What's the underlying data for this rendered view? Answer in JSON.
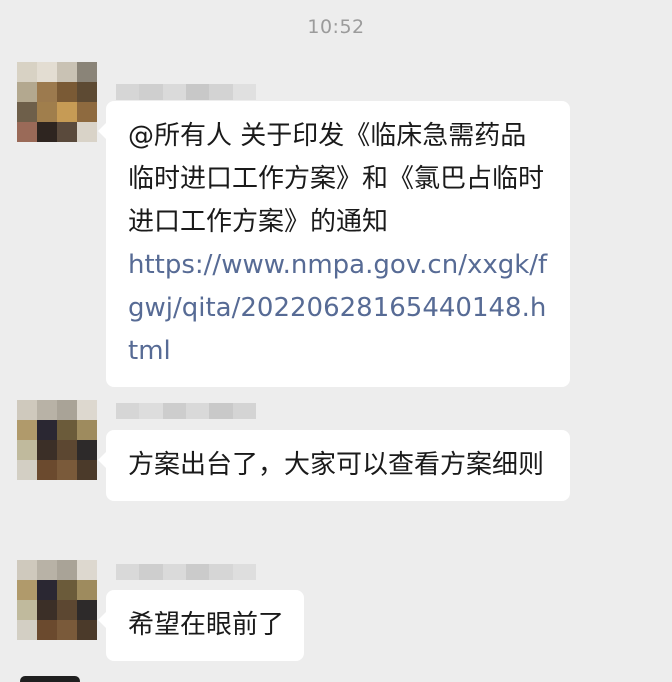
{
  "chat": {
    "timestamp": "10:52",
    "messages": [
      {
        "text": "@所有人  关于印发《临床急需药品临时进口工作方案》和《氯巴占临时进口工作方案》的通知",
        "link": "https://www.nmpa.gov.cn/xxgk/fgwj/qita/20220628165440148.html"
      },
      {
        "text": "方案出台了，大家可以查看方案细则"
      },
      {
        "text": "希望在眼前了"
      }
    ]
  },
  "colors": {
    "background": "#ededed",
    "bubble": "#ffffff",
    "link": "#576b95",
    "timestamp": "#9b9b9b"
  },
  "icons": {
    "avatar": "blurred-avatar",
    "nickname": "blurred-nickname"
  }
}
